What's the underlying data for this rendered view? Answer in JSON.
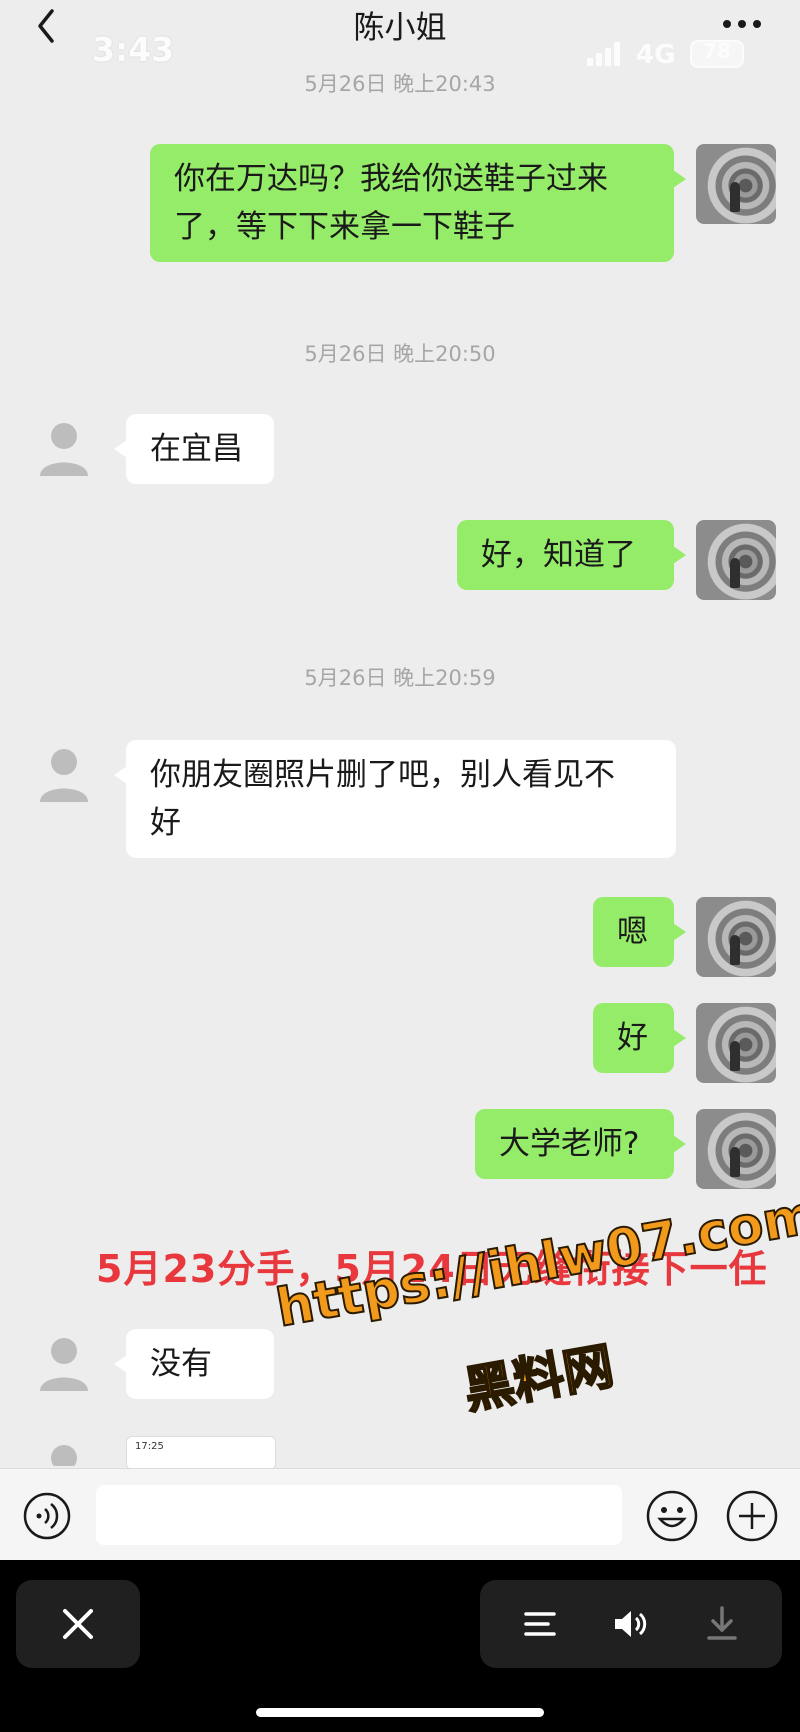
{
  "header": {
    "title": "陈小姐",
    "time": "3:43",
    "network": "4G",
    "battery": "78"
  },
  "messages": [
    {
      "type": "timestamp",
      "text": "5月26日 晚上20:43"
    },
    {
      "type": "sent",
      "text_lines": [
        "你在万达吗？我给你送鞋子过来",
        "了，等下下来拿一下鞋子"
      ]
    },
    {
      "type": "timestamp",
      "text": "5月26日 晚上20:50"
    },
    {
      "type": "received",
      "text": "在宜昌"
    },
    {
      "type": "sent",
      "text": "好，知道了"
    },
    {
      "type": "timestamp",
      "text": "5月26日 晚上20:59"
    },
    {
      "type": "received",
      "text_lines": [
        "你朋友圈照片删了吧，别人看见不",
        "好"
      ]
    },
    {
      "type": "sent",
      "text": "嗯"
    },
    {
      "type": "sent",
      "text": "好"
    },
    {
      "type": "sent",
      "text": "大学老师?"
    },
    {
      "type": "received",
      "text": "没有"
    }
  ],
  "watermark": {
    "caption": "5月23分手，5月24日无缝衔接下一任",
    "url": "https://ihlw07.com",
    "site": "黑料网"
  },
  "thumbnail": {
    "time": "17:25"
  },
  "icons": {
    "back": "chevron-left-icon",
    "more": "more-dots-icon",
    "voice": "voice-icon",
    "emoji": "emoji-icon",
    "plus": "plus-icon",
    "close": "close-icon",
    "menu": "menu-icon",
    "volume": "volume-icon",
    "download": "download-icon"
  },
  "colors": {
    "sent_bubble": "#95ec69",
    "received_bubble": "#ffffff",
    "background": "#ededed",
    "watermark_red": "#e8383d",
    "watermark_orange": "#f29a1c"
  }
}
